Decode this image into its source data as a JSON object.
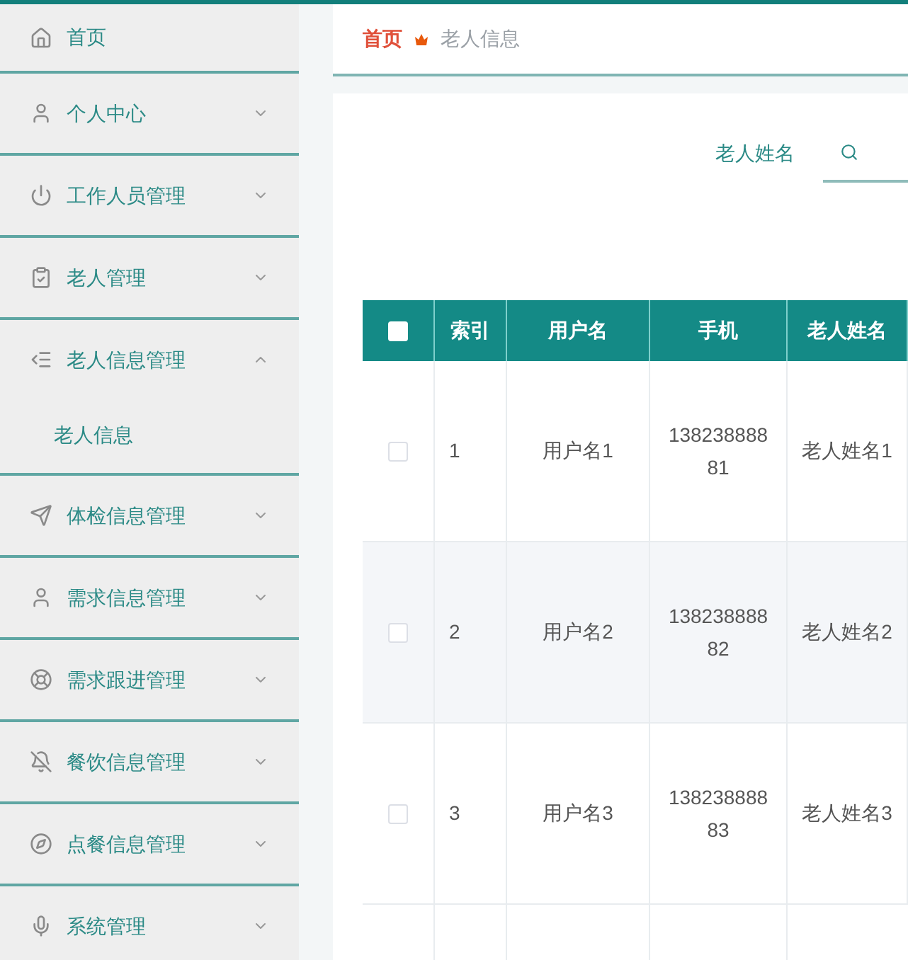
{
  "sidebar": {
    "items": [
      {
        "label": "首页"
      },
      {
        "label": "个人中心",
        "expanded": false
      },
      {
        "label": "工作人员管理",
        "expanded": false
      },
      {
        "label": "老人管理",
        "expanded": false
      },
      {
        "label": "老人信息管理",
        "expanded": true,
        "children": [
          {
            "label": "老人信息"
          }
        ]
      },
      {
        "label": "体检信息管理",
        "expanded": false
      },
      {
        "label": "需求信息管理",
        "expanded": false
      },
      {
        "label": "需求跟进管理",
        "expanded": false
      },
      {
        "label": "餐饮信息管理",
        "expanded": false
      },
      {
        "label": "点餐信息管理",
        "expanded": false
      },
      {
        "label": "系统管理",
        "expanded": false
      }
    ]
  },
  "breadcrumb": [
    {
      "label": "首页",
      "current": false
    },
    {
      "label": "老人信息",
      "current": true
    }
  ],
  "search": {
    "label": "老人姓名"
  },
  "table": {
    "select_all": {
      "checked": false
    },
    "columns": [
      "索引",
      "用户名",
      "手机",
      "老人姓名"
    ],
    "rows": [
      {
        "selected": false,
        "cells": [
          "1",
          "用户名1",
          "13823888881",
          "老人姓名1"
        ]
      },
      {
        "selected": false,
        "cells": [
          "2",
          "用户名2",
          "13823888882",
          "老人姓名2"
        ]
      },
      {
        "selected": false,
        "cells": [
          "3",
          "用户名3",
          "13823888883",
          "老人姓名3"
        ]
      }
    ]
  }
}
